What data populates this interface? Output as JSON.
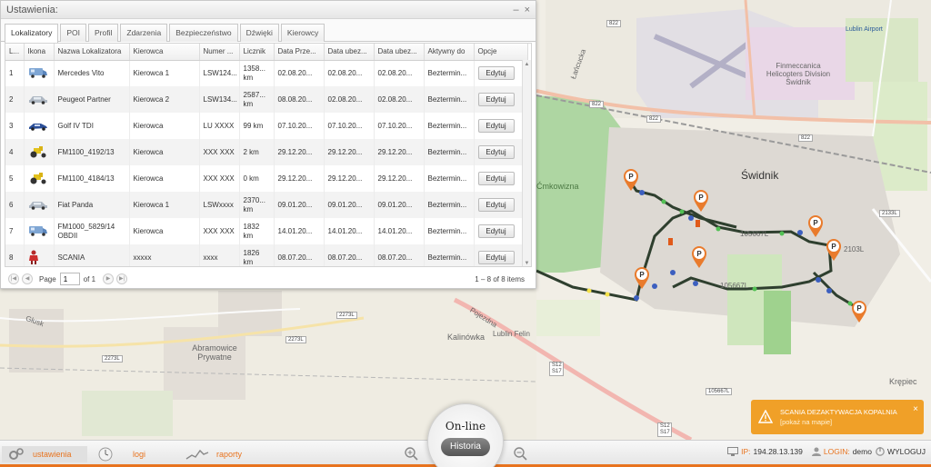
{
  "window": {
    "title": "Ustawienia:",
    "minimize": "–",
    "close": "×"
  },
  "tabs": [
    {
      "label": "Lokalizatory"
    },
    {
      "label": "POI"
    },
    {
      "label": "Profil"
    },
    {
      "label": "Zdarzenia"
    },
    {
      "label": "Bezpieczeństwo"
    },
    {
      "label": "Dźwięki"
    },
    {
      "label": "Kierowcy"
    }
  ],
  "table": {
    "headers": [
      "L...",
      "Ikona",
      "Nazwa Lokalizatora",
      "Kierowca",
      "Numer ...",
      "Licznik",
      "Data Prze...",
      "Data ubez...",
      "Data ubez...",
      "Aktywny do",
      "Opcje"
    ],
    "rows": [
      {
        "lp": "1",
        "icon": "van-icon",
        "name": "Mercedes Vito",
        "driver": "Kierowca 1",
        "number": "LSW124...",
        "counter": "1358... km",
        "d1": "02.08.20...",
        "d2": "02.08.20...",
        "d3": "02.08.20...",
        "active": "Beztermin...",
        "btn": "Edytuj"
      },
      {
        "lp": "2",
        "icon": "car-icon",
        "name": "Peugeot Partner",
        "driver": "Kierowca 2",
        "number": "LSW134...",
        "counter": "2587... km",
        "d1": "08.08.20...",
        "d2": "02.08.20...",
        "d3": "02.08.20...",
        "active": "Beztermin...",
        "btn": "Edytuj"
      },
      {
        "lp": "3",
        "icon": "sportscar-icon",
        "name": "Golf IV TDI",
        "driver": "Kierowca",
        "number": "LU XXXX",
        "counter": "99 km",
        "d1": "07.10.20...",
        "d2": "07.10.20...",
        "d3": "07.10.20...",
        "active": "Beztermin...",
        "btn": "Edytuj"
      },
      {
        "lp": "4",
        "icon": "tractor-icon",
        "name": "FM1100_4192/13",
        "driver": "Kierowca",
        "number": "XXX XXX",
        "counter": "2 km",
        "d1": "29.12.20...",
        "d2": "29.12.20...",
        "d3": "29.12.20...",
        "active": "Beztermin...",
        "btn": "Edytuj"
      },
      {
        "lp": "5",
        "icon": "tractor-icon",
        "name": "FM1100_4184/13",
        "driver": "Kierowca",
        "number": "XXX XXX",
        "counter": "0 km",
        "d1": "29.12.20...",
        "d2": "29.12.20...",
        "d3": "29.12.20...",
        "active": "Beztermin...",
        "btn": "Edytuj"
      },
      {
        "lp": "6",
        "icon": "car-icon",
        "name": "Fiat Panda",
        "driver": "Kierowca 1",
        "number": "LSWxxxx",
        "counter": "2370... km",
        "d1": "09.01.20...",
        "d2": "09.01.20...",
        "d3": "09.01.20...",
        "active": "Beztermin...",
        "btn": "Edytuj"
      },
      {
        "lp": "7",
        "icon": "van-icon",
        "name": "FM1000_5829/14 OBDII",
        "driver": "Kierowca",
        "number": "XXX XXX",
        "counter": "1832 km",
        "d1": "14.01.20...",
        "d2": "14.01.20...",
        "d3": "14.01.20...",
        "active": "Beztermin...",
        "btn": "Edytuj"
      },
      {
        "lp": "8",
        "icon": "person-icon",
        "name": "SCANIA",
        "driver": "xxxxx",
        "number": "xxxx",
        "counter": "1826 km",
        "d1": "08.07.20...",
        "d2": "08.07.20...",
        "d3": "08.07.20...",
        "active": "Beztermin...",
        "btn": "Edytuj"
      }
    ]
  },
  "pager": {
    "page_label": "Page",
    "page_value": "1",
    "of_label": "of 1",
    "info": "1 – 8 of 8 items"
  },
  "map": {
    "labels": {
      "swidnik": "Świdnik",
      "airport": "Lublin Airport",
      "finmeccanica": "Finmeccanica Helicopters Division Świdnik",
      "kalinowka": "Kalinówka",
      "krepiec": "Krępiec",
      "abramowice": "Abramowice Prywatne",
      "kowizna": "Ćmkowizna",
      "r822a": "822",
      "r822b": "822",
      "r822c": "822",
      "r822d": "822",
      "r2133": "2133L",
      "r105667": "105667L",
      "r105667b": "105667L",
      "r105667c": "105667L",
      "r2103": "2103L",
      "r2273a": "2273L",
      "r2273b": "2273L",
      "r2273c": "2273L",
      "rs12": "S12 S17",
      "rs17": "S12 S17",
      "lublin_felin": "Lublin Felin",
      "lancucka": "Łańcucka",
      "pojezdna": "Pojezdna",
      "glusk": "Głusk"
    }
  },
  "notification": {
    "title": "SCANIA DEZAKTYWACJA KOPALNIA",
    "link": "[pokaż na mapie]",
    "close": "×",
    "color": "#f0a028"
  },
  "modes": {
    "online": "On-line",
    "historia": "Historia"
  },
  "bottombar": {
    "settings": "ustawienia",
    "logs": "logi",
    "reports": "raporty",
    "ip_label": "IP:",
    "ip_value": "194.28.13.139",
    "login_label": "LOGIN:",
    "login_value": "demo",
    "logout": "WYLOGUJ",
    "accent": "#e8731e"
  }
}
